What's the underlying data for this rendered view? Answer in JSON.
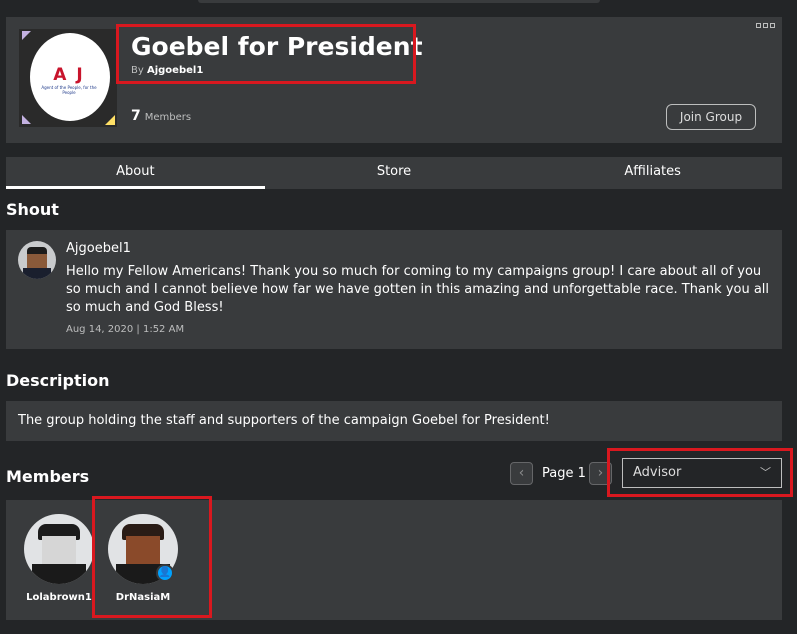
{
  "group": {
    "name": "Goebel for President",
    "by_label": "By",
    "owner": "Ajgoebel1",
    "member_count": "7",
    "member_label": "Members",
    "join_label": "Join Group",
    "emblem": {
      "logo_text": "A J",
      "tagline": "Agent of the People, for the People"
    }
  },
  "tabs": [
    {
      "label": "About",
      "active": true
    },
    {
      "label": "Store",
      "active": false
    },
    {
      "label": "Affiliates",
      "active": false
    }
  ],
  "shout": {
    "title": "Shout",
    "author": "Ajgoebel1",
    "message": "Hello my Fellow Americans! Thank you so much for coming to my campaigns group! I care about all of you so much and I cannot believe how far we have gotten in this amazing and unforgettable race. Thank you all so much and God Bless!",
    "date": "Aug 14, 2020 | 1:52 AM"
  },
  "description": {
    "title": "Description",
    "text": "The group holding the staff and supporters of the campaign Goebel for President!"
  },
  "members": {
    "title": "Members",
    "page_label": "Page 1",
    "role_selected": "Advisor",
    "list": [
      {
        "name": "Lolabrown1"
      },
      {
        "name": "DrNasiaM",
        "badge": "person-icon"
      }
    ]
  },
  "colors": {
    "highlight": "#d9181f",
    "panel": "#393b3d",
    "background": "#232527",
    "badge": "#00a2ff"
  }
}
